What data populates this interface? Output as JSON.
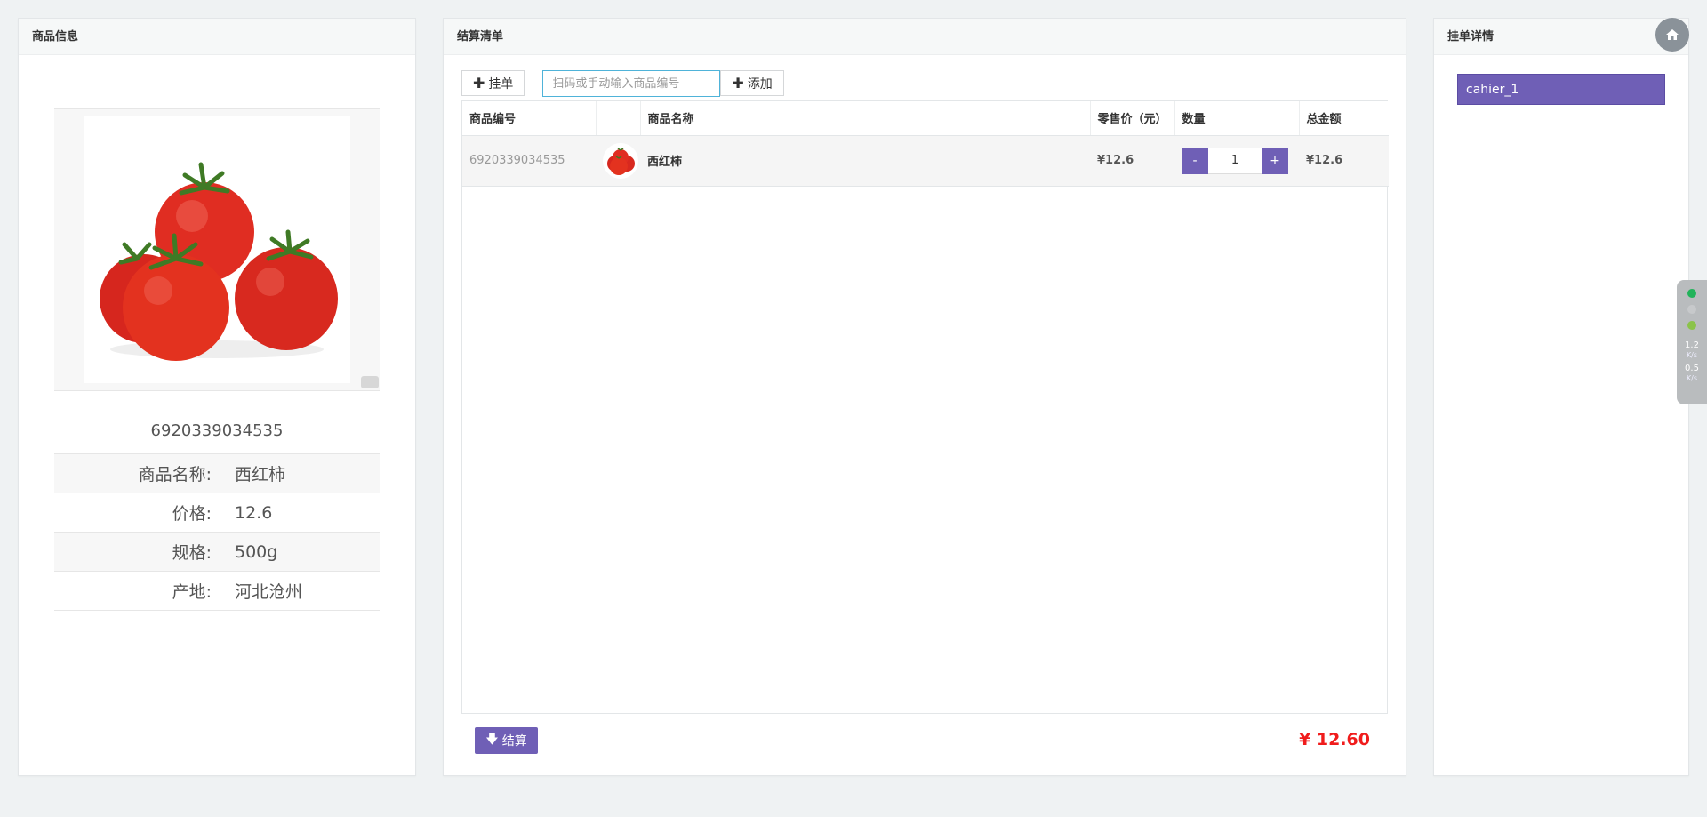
{
  "left_panel": {
    "title": "商品信息",
    "product_code": "6920339034535",
    "details": [
      {
        "label": "商品名称:",
        "value": "西红柿"
      },
      {
        "label": "价格:",
        "value": "12.6"
      },
      {
        "label": "规格:",
        "value": "500g"
      },
      {
        "label": "产地:",
        "value": "河北沧州"
      }
    ]
  },
  "middle_panel": {
    "title": "结算清单",
    "hold_button": "挂单",
    "search_placeholder": "扫码或手动输入商品编号",
    "add_button": "添加",
    "columns": [
      "商品编号",
      "",
      "商品名称",
      "零售价（元）",
      "数量",
      "总金额"
    ],
    "rows": [
      {
        "code": "6920339034535",
        "name": "西红柿",
        "price": "¥12.6",
        "quantity": "1",
        "total": "¥12.6"
      }
    ],
    "qty_minus": "-",
    "qty_plus": "+",
    "checkout_button": "结算",
    "grand_total": "¥ 12.60"
  },
  "right_panel": {
    "title": "挂单详情",
    "orders": [
      "cahier_1"
    ]
  },
  "net_widget": {
    "upload": "1.2",
    "upload_unit": "K/s",
    "download": "0.5",
    "download_unit": "K/s"
  },
  "colors": {
    "accent": "#6f5fb6",
    "total_red": "#f01c1c",
    "input_border": "#4fb3d9"
  }
}
